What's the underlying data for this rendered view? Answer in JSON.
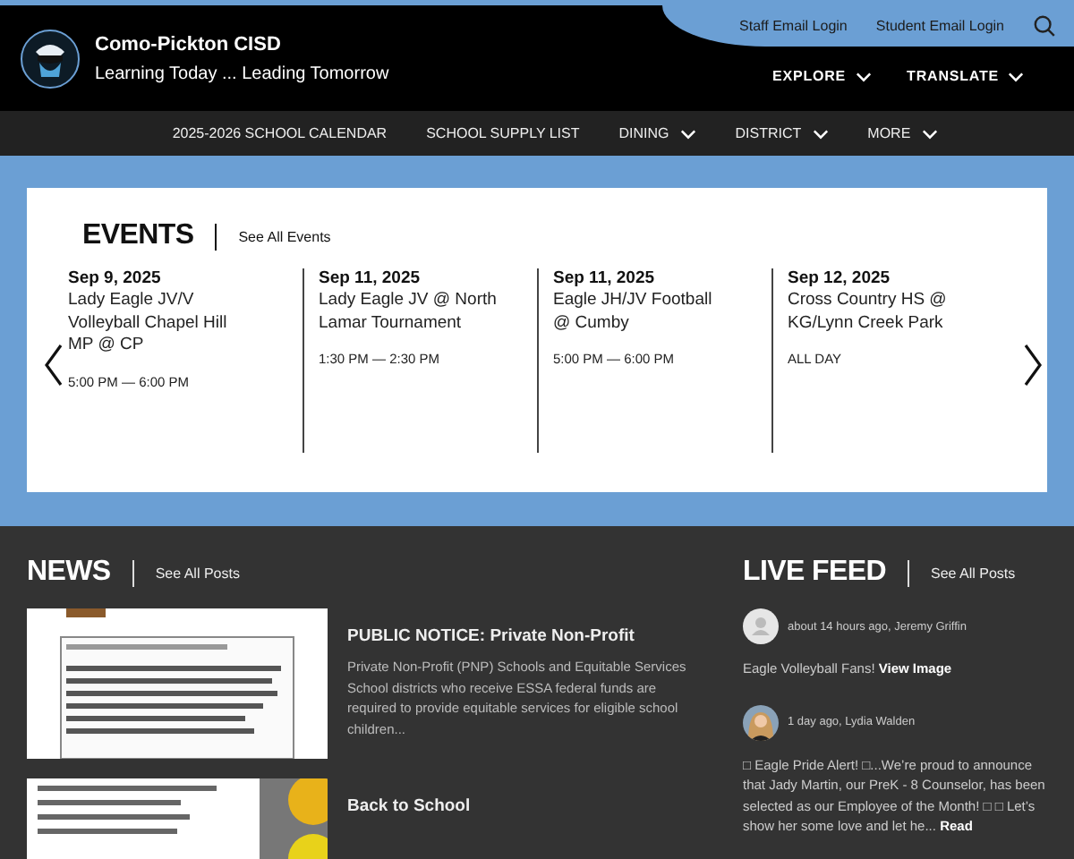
{
  "header": {
    "site_name": "Como-Pickton CISD",
    "tagline": "Learning Today ... Leading Tomorrow",
    "utility_links": [
      "Staff Email Login",
      "Student Email Login"
    ],
    "menus": [
      "EXPLORE",
      "TRANSLATE"
    ]
  },
  "nav": [
    {
      "label": "2025-2026 SCHOOL CALENDAR",
      "dropdown": false
    },
    {
      "label": "SCHOOL SUPPLY LIST",
      "dropdown": false
    },
    {
      "label": "DINING",
      "dropdown": true
    },
    {
      "label": "DISTRICT",
      "dropdown": true
    },
    {
      "label": "MORE",
      "dropdown": true
    }
  ],
  "events": {
    "heading": "EVENTS",
    "link": "See All Events",
    "items": [
      {
        "date": "Sep 9, 2025",
        "title": "Lady Eagle JV/V Volleyball Chapel Hill MP @ CP",
        "time": "5:00 PM — 6:00 PM"
      },
      {
        "date": "Sep 11, 2025",
        "title": "Lady Eagle JV @ North Lamar Tournament",
        "time": "1:30 PM — 2:30 PM"
      },
      {
        "date": "Sep 11, 2025",
        "title": "Eagle JH/JV Football @ Cumby",
        "time": "5:00 PM — 6:00 PM"
      },
      {
        "date": "Sep 12, 2025",
        "title": "Cross Country HS @ KG/Lynn Creek Park",
        "time": "ALL DAY"
      }
    ]
  },
  "news": {
    "heading": "NEWS",
    "link": "See All Posts",
    "posts": [
      {
        "title": "PUBLIC NOTICE: Private Non-Profit",
        "summary": "Private Non-Profit (PNP) Schools and Equitable Services School districts who receive ESSA federal funds are required to provide equitable services for eligible school children..."
      },
      {
        "title": "Back to School"
      }
    ]
  },
  "live_feed": {
    "heading": "LIVE FEED",
    "link": "See All Posts",
    "posts": [
      {
        "kind": "placeholder",
        "meta": "about 14 hours ago, Jeremy Griffin",
        "text": "Eagle Volleyball Fans!",
        "link": "View Image"
      },
      {
        "meta": "1 day ago, Lydia Walden",
        "text": "□ Eagle Pride Alert! □...We’re proud to announce that Jady Martin, our PreK - 8 Counselor, has been selected as our Employee of the Month! □ □ Let’s show her some love and let he...",
        "link": "Read"
      }
    ]
  }
}
